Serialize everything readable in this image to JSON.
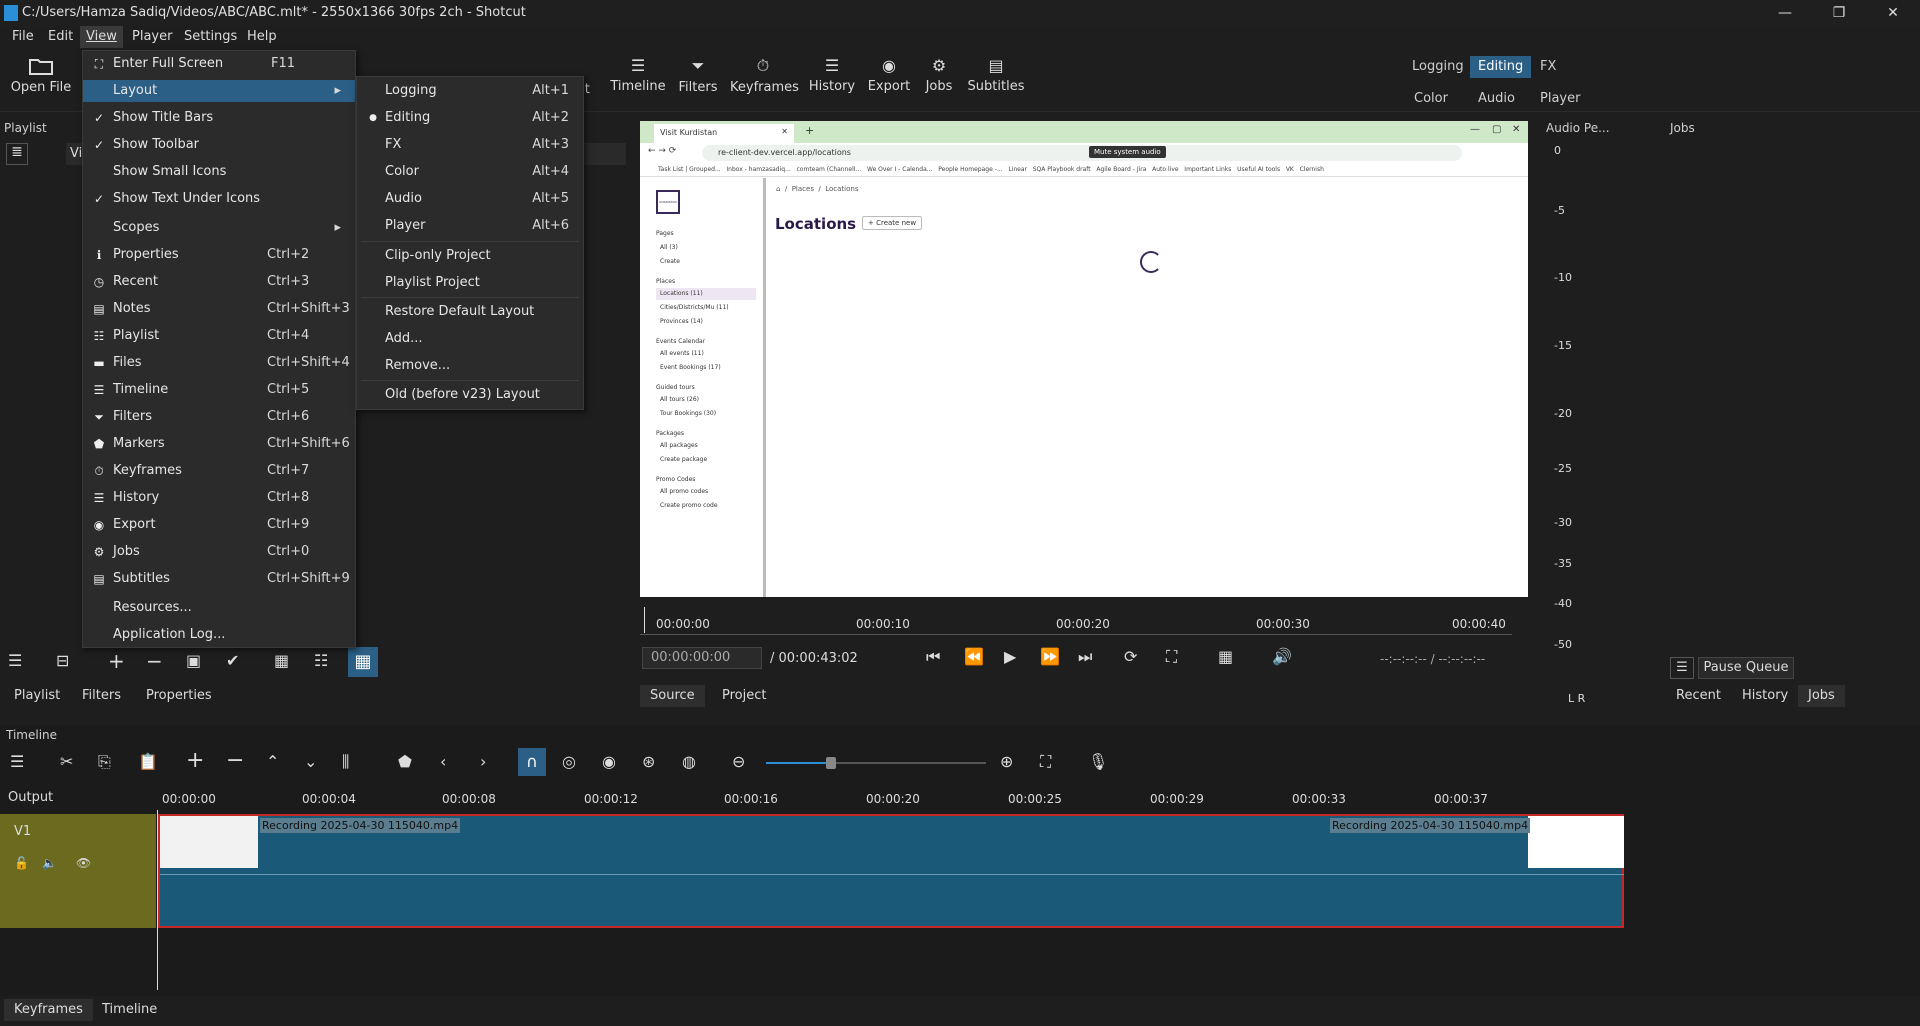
{
  "window": {
    "title": "C:/Users/Hamza Sadiq/Videos/ABC/ABC.mlt* - 2550x1366 30fps 2ch - Shotcut",
    "minimize": "—",
    "maximize": "❐",
    "close": "✕"
  },
  "menubar": [
    "File",
    "Edit",
    "View",
    "Player",
    "Settings",
    "Help"
  ],
  "toolbar": {
    "open_file": "Open File",
    "buttons": [
      "Timeline",
      "Filters",
      "Keyframes",
      "History",
      "Export",
      "Jobs",
      "Subtitles"
    ],
    "partial_label": "st",
    "layouts_top": [
      "Logging",
      "Editing",
      "FX"
    ],
    "layouts_bottom": [
      "Color",
      "Audio",
      "Player"
    ],
    "selected_layout": "Editing"
  },
  "view_menu": [
    {
      "label": "Enter Full Screen",
      "shortcut": "F11",
      "icon": "fullscreen-icon"
    },
    {
      "label": "Layout",
      "shortcut": "",
      "submenu": true,
      "highlight": true
    },
    {
      "label": "Show Title Bars",
      "shortcut": "",
      "check": true
    },
    {
      "label": "Show Toolbar",
      "shortcut": "",
      "check": true
    },
    {
      "label": "Show Small Icons",
      "shortcut": ""
    },
    {
      "label": "Show Text Under Icons",
      "shortcut": "",
      "check": true
    },
    {
      "label": "Scopes",
      "shortcut": "",
      "submenu": true
    },
    {
      "label": "Properties",
      "shortcut": "Ctrl+2",
      "icon": "info-icon"
    },
    {
      "label": "Recent",
      "shortcut": "Ctrl+3",
      "icon": "clock-icon"
    },
    {
      "label": "Notes",
      "shortcut": "Ctrl+Shift+3",
      "icon": "notes-icon"
    },
    {
      "label": "Playlist",
      "shortcut": "Ctrl+4",
      "icon": "list-icon"
    },
    {
      "label": "Files",
      "shortcut": "Ctrl+Shift+4",
      "icon": "files-icon"
    },
    {
      "label": "Timeline",
      "shortcut": "Ctrl+5",
      "icon": "timeline-icon"
    },
    {
      "label": "Filters",
      "shortcut": "Ctrl+6",
      "icon": "filter-icon"
    },
    {
      "label": "Markers",
      "shortcut": "Ctrl+Shift+6",
      "icon": "marker-icon"
    },
    {
      "label": "Keyframes",
      "shortcut": "Ctrl+7",
      "icon": "keyframes-icon"
    },
    {
      "label": "History",
      "shortcut": "Ctrl+8",
      "icon": "history-icon"
    },
    {
      "label": "Export",
      "shortcut": "Ctrl+9",
      "icon": "export-icon"
    },
    {
      "label": "Jobs",
      "shortcut": "Ctrl+0",
      "icon": "gear-icon"
    },
    {
      "label": "Subtitles",
      "shortcut": "Ctrl+Shift+9",
      "icon": "subtitles-icon"
    },
    {
      "label": "Resources...",
      "shortcut": ""
    },
    {
      "label": "Application Log...",
      "shortcut": ""
    }
  ],
  "layout_submenu": [
    {
      "label": "Logging",
      "shortcut": "Alt+1"
    },
    {
      "label": "Editing",
      "shortcut": "Alt+2",
      "radio": true
    },
    {
      "label": "FX",
      "shortcut": "Alt+3"
    },
    {
      "label": "Color",
      "shortcut": "Alt+4"
    },
    {
      "label": "Audio",
      "shortcut": "Alt+5"
    },
    {
      "label": "Player",
      "shortcut": "Alt+6"
    },
    {
      "label": "Clip-only Project",
      "shortcut": ""
    },
    {
      "label": "Playlist Project",
      "shortcut": ""
    },
    {
      "label": "Restore Default Layout",
      "shortcut": ""
    },
    {
      "label": "Add...",
      "shortcut": ""
    },
    {
      "label": "Remove...",
      "shortcut": ""
    },
    {
      "label": "Old (before v23) Layout",
      "shortcut": ""
    }
  ],
  "playlist_panel": {
    "title": "Playlist",
    "partial": "Vi",
    "tabs": [
      "Playlist",
      "Filters",
      "Properties"
    ]
  },
  "player": {
    "timecode": "00:00:00:00",
    "duration": "/  00:00:43:02",
    "in_out": "--:--:--:--  /  --:--:--:--",
    "ruler": [
      "00:00:00",
      "00:00:10",
      "00:00:20",
      "00:00:30",
      "00:00:40"
    ],
    "tabs": [
      "Source",
      "Project"
    ]
  },
  "browser_preview": {
    "tab_title": "Visit Kurdistan",
    "url": "re-client-dev.vercel.app/locations",
    "tooltip": "Mute system audio",
    "bookmarks": [
      "Task List | Grouped...",
      "Inbox - hamzasadiq...",
      "comteam (ChannelI...",
      "We Over I - Calenda...",
      "People Homepage -...",
      "Linear",
      "SQA Playbook draft",
      "Agile Board - Jira",
      "Auto live",
      "Important Links",
      "Useful AI tools",
      "VK",
      "Clernish"
    ],
    "breadcrumb": [
      "Places",
      "Locations"
    ],
    "heading": "Locations",
    "create_new": "+ Create new",
    "logo_text": "KURDISTAN",
    "sidebar": [
      {
        "section": "Pages",
        "items": [
          "All (3)",
          "Create"
        ]
      },
      {
        "section": "Places",
        "items": [
          "Locations (11)",
          "Cities/Districts/Mu (11)",
          "Provinces (14)"
        ]
      },
      {
        "section": "Events Calendar",
        "items": [
          "All events (11)",
          "Event Bookings (17)"
        ]
      },
      {
        "section": "Guided tours",
        "items": [
          "All tours (26)",
          "Tour Bookings (30)"
        ]
      },
      {
        "section": "Packages",
        "items": [
          "All packages",
          "Create package"
        ]
      },
      {
        "section": "Promo Codes",
        "items": [
          "All promo codes",
          "Create promo code"
        ]
      }
    ]
  },
  "audio_panel": {
    "title": "Audio Pe...",
    "scale": [
      "0",
      "-5",
      "-10",
      "-15",
      "-20",
      "-25",
      "-30",
      "-35",
      "-40",
      "-50"
    ],
    "channels": "L  R"
  },
  "jobs_panel": {
    "title": "Jobs",
    "pause_queue": "Pause Queue",
    "tabs": [
      "Recent",
      "History",
      "Jobs"
    ]
  },
  "timeline": {
    "title": "Timeline",
    "output": "Output",
    "track": "V1",
    "ruler": [
      "00:00:00",
      "00:00:04",
      "00:00:08",
      "00:00:12",
      "00:00:16",
      "00:00:20",
      "00:00:25",
      "00:00:29",
      "00:00:33",
      "00:00:37"
    ],
    "clip_label_left": "Recording 2025-04-30 115040.mp4",
    "clip_label_right": "Recording 2025-04-30 115040.mp4"
  },
  "bottom_tabs": [
    "Keyframes",
    "Timeline"
  ],
  "colors": {
    "accent": "#2b5f86",
    "clip": "#1a5a78",
    "track_head": "#6b6a1e",
    "clip_border": "#c62828"
  }
}
